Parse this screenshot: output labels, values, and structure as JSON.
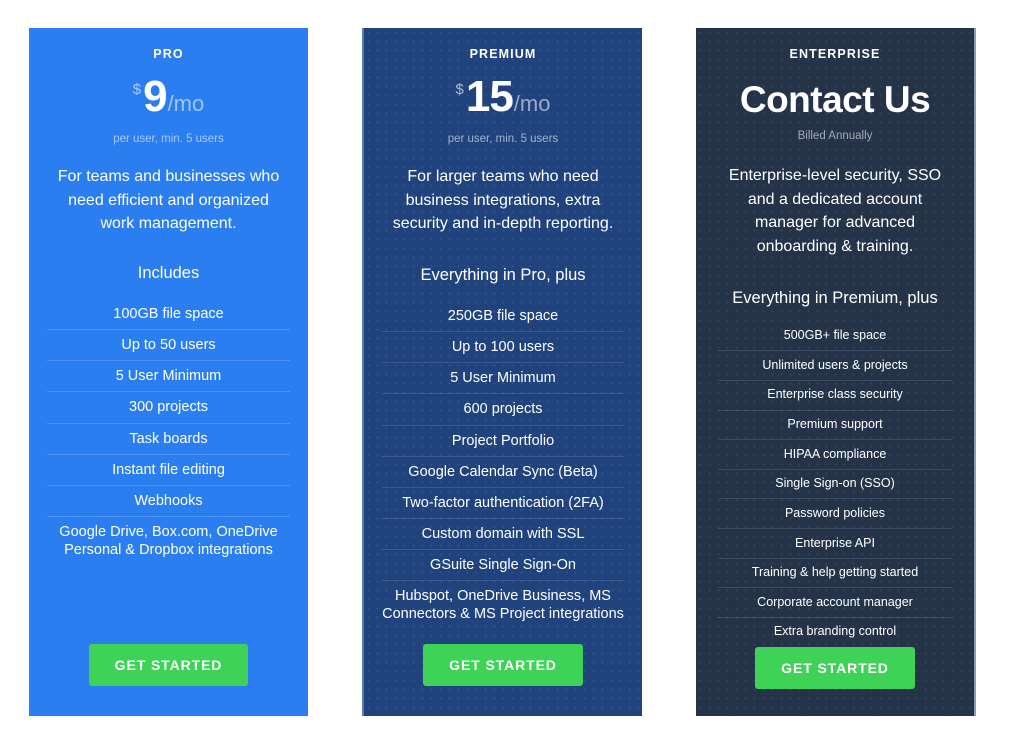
{
  "page": {
    "background_color": "#ffffff",
    "cta_color": "#3ed256"
  },
  "plans": [
    {
      "name": "PRO",
      "accent_color": "#2a7ef0",
      "price_currency": "$",
      "price_amount": "9",
      "price_period": "/mo",
      "price_note": "per user, min. 5 users",
      "description": "For teams and businesses who need efficient and organized work management.",
      "includes_heading": "Includes",
      "features": [
        "100GB file space",
        "Up to 50 users",
        "5 User Minimum",
        "300 projects",
        "Task boards",
        "Instant file editing",
        "Webhooks",
        "Google Drive, Box.com, OneDrive Personal & Dropbox integrations"
      ],
      "cta_label": "GET STARTED"
    },
    {
      "name": "PREMIUM",
      "accent_color": "#20437e",
      "price_currency": "$",
      "price_amount": "15",
      "price_period": "/mo",
      "price_note": "per user, min. 5 users",
      "description": "For larger teams who need business integrations, extra security and in-depth reporting.",
      "includes_heading": "Everything in Pro, plus",
      "features": [
        "250GB file space",
        "Up to 100 users",
        "5 User Minimum",
        "600 projects",
        "Project Portfolio",
        "Google Calendar Sync (Beta)",
        "Two-factor authentication (2FA)",
        "Custom domain with SSL",
        "GSuite Single Sign-On",
        "Hubspot, OneDrive Business, MS Connectors & MS Project integrations"
      ],
      "cta_label": "GET STARTED"
    },
    {
      "name": "ENTERPRISE",
      "accent_color": "#253349",
      "contact_title": "Contact Us",
      "price_note": "Billed Annually",
      "description": "Enterprise-level security, SSO and a dedicated account manager for advanced onboarding & training.",
      "includes_heading": "Everything in Premium, plus",
      "features": [
        "500GB+ file space",
        "Unlimited users & projects",
        "Enterprise class security",
        "Premium support",
        "HIPAA compliance",
        "Single Sign-on (SSO)",
        "Password policies",
        "Enterprise API",
        "Training & help getting started",
        "Corporate account manager",
        "Extra branding control"
      ],
      "cta_label": "GET STARTED"
    }
  ]
}
